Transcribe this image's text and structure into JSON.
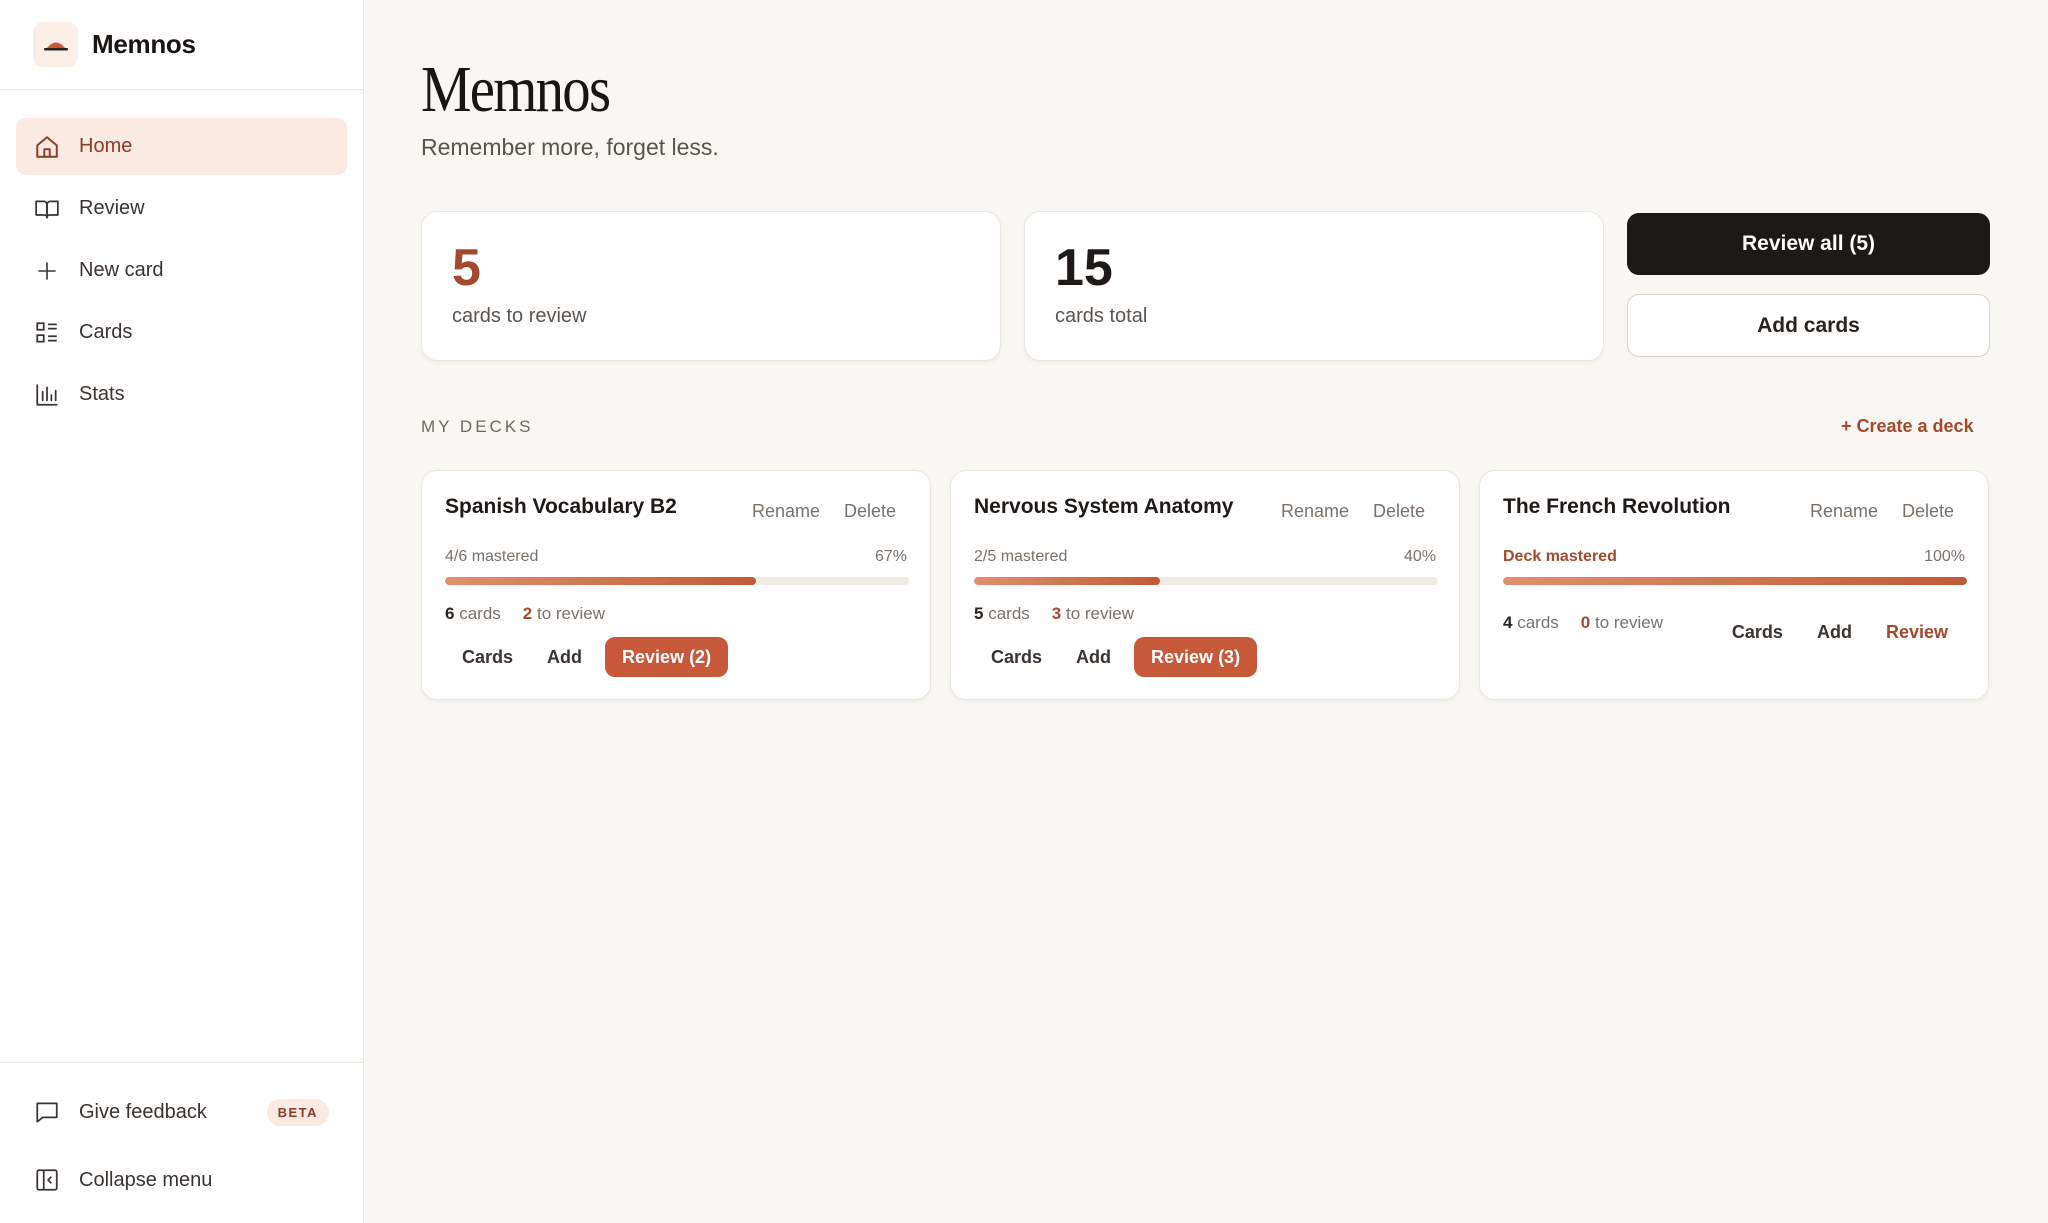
{
  "app": {
    "name": "Memnos"
  },
  "sidebar": {
    "items": [
      {
        "label": "Home",
        "icon": "home-icon",
        "active": true
      },
      {
        "label": "Review",
        "icon": "book-icon"
      },
      {
        "label": "New card",
        "icon": "plus-icon"
      },
      {
        "label": "Cards",
        "icon": "list-icon"
      },
      {
        "label": "Stats",
        "icon": "bar-chart-icon"
      }
    ],
    "feedback_label": "Give feedback",
    "beta_badge": "BETA",
    "collapse_label": "Collapse menu"
  },
  "header": {
    "title": "Memnos",
    "subtitle": "Remember more, forget less."
  },
  "stats": {
    "to_review": {
      "value": "5",
      "label": "cards to review"
    },
    "total": {
      "value": "15",
      "label": "cards total"
    }
  },
  "actions": {
    "review_all": "Review all (5)",
    "add_cards": "Add cards"
  },
  "decks_section": {
    "label": "MY DECKS",
    "create_label": "+ Create a deck"
  },
  "decks": [
    {
      "title": "Spanish Vocabulary B2",
      "rename": "Rename",
      "delete": "Delete",
      "mastered": "4/6 mastered",
      "percent": "67%",
      "progress": 0.67,
      "cards_count": "6",
      "cards_suffix": "cards",
      "review_count": "2",
      "review_suffix": "to review",
      "btn_cards": "Cards",
      "btn_add": "Add",
      "btn_review": "Review (2)"
    },
    {
      "title": "Nervous System Anatomy",
      "rename": "Rename",
      "delete": "Delete",
      "mastered": "2/5 mastered",
      "percent": "40%",
      "progress": 0.4,
      "cards_count": "5",
      "cards_suffix": "cards",
      "review_count": "3",
      "review_suffix": "to review",
      "btn_cards": "Cards",
      "btn_add": "Add",
      "btn_review": "Review (3)"
    },
    {
      "title": "The French Revolution",
      "rename": "Rename",
      "delete": "Delete",
      "mastered": "Deck mastered",
      "percent": "100%",
      "progress": 1.0,
      "cards_count": "4",
      "cards_suffix": "cards",
      "review_count": "0",
      "review_suffix": "to review",
      "btn_cards": "Cards",
      "btn_add": "Add",
      "btn_review": "Review"
    }
  ],
  "colors": {
    "accent": "#c7593a",
    "accent_dark": "#a44a2c",
    "active_bg": "#fbeae1",
    "page_bg": "#f9f7f4"
  }
}
